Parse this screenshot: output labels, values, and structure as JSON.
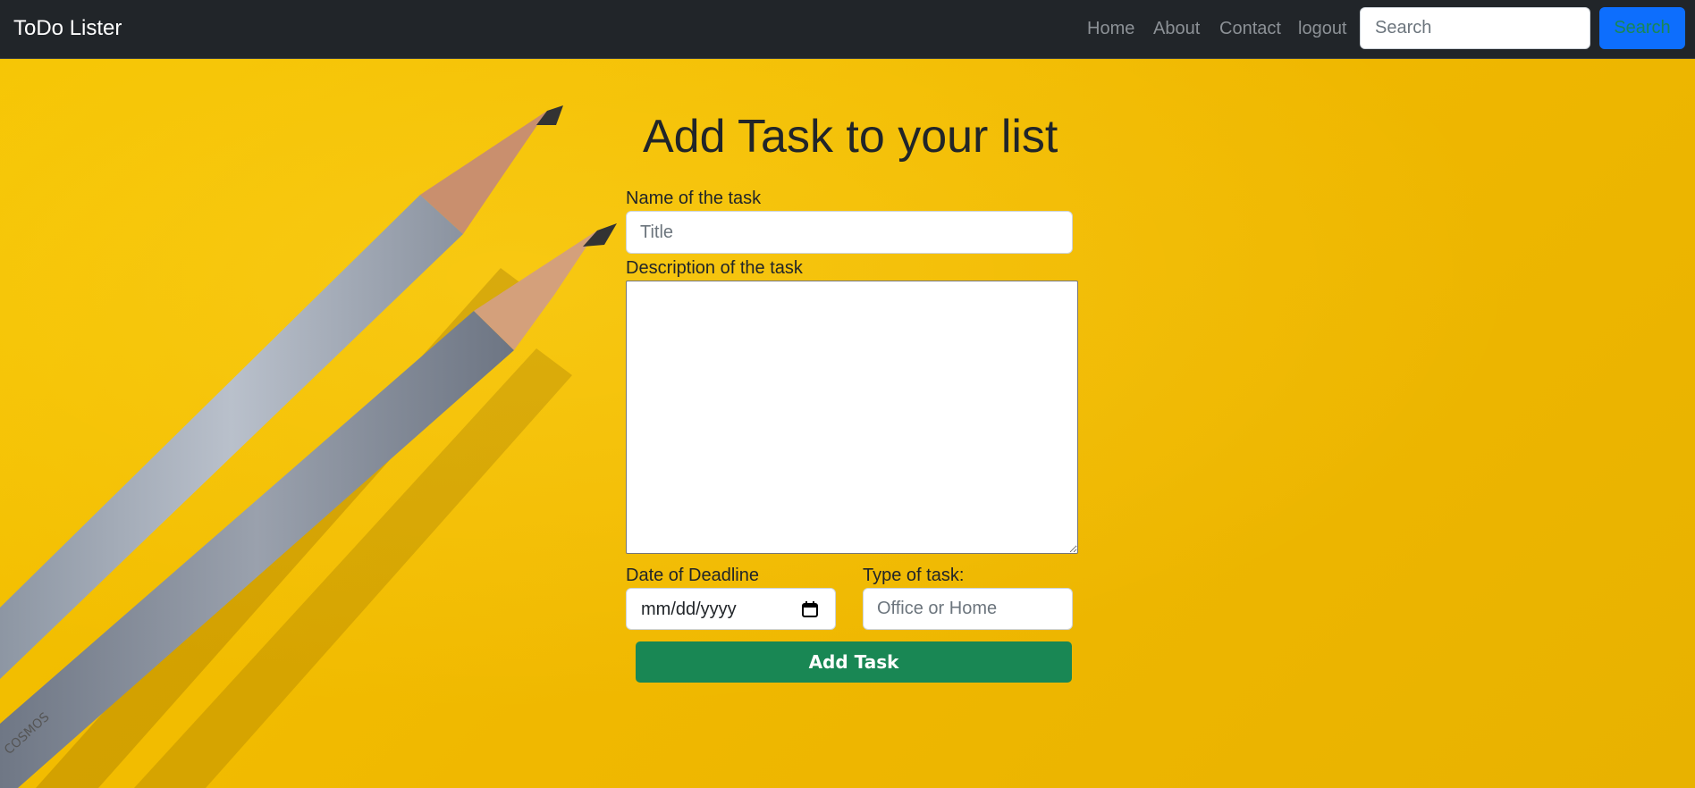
{
  "navbar": {
    "brand": "ToDo Lister",
    "links": [
      "Home",
      "About",
      "Contact",
      "logout"
    ],
    "search_placeholder": "Search",
    "search_button": "Search"
  },
  "form": {
    "heading": "Add Task to your list",
    "name_label": "Name of the task",
    "name_placeholder": "Title",
    "description_label": "Description of the task",
    "deadline_label": "Date of Deadline",
    "deadline_placeholder": "mm/dd/yyyy",
    "type_label": "Type of task:",
    "type_placeholder": "Office or Home",
    "submit_label": "Add Task"
  },
  "colors": {
    "navbar_bg": "#212529",
    "background": "#f2bd0a",
    "search_button_bg": "#0d6efd",
    "submit_bg": "#198754"
  }
}
